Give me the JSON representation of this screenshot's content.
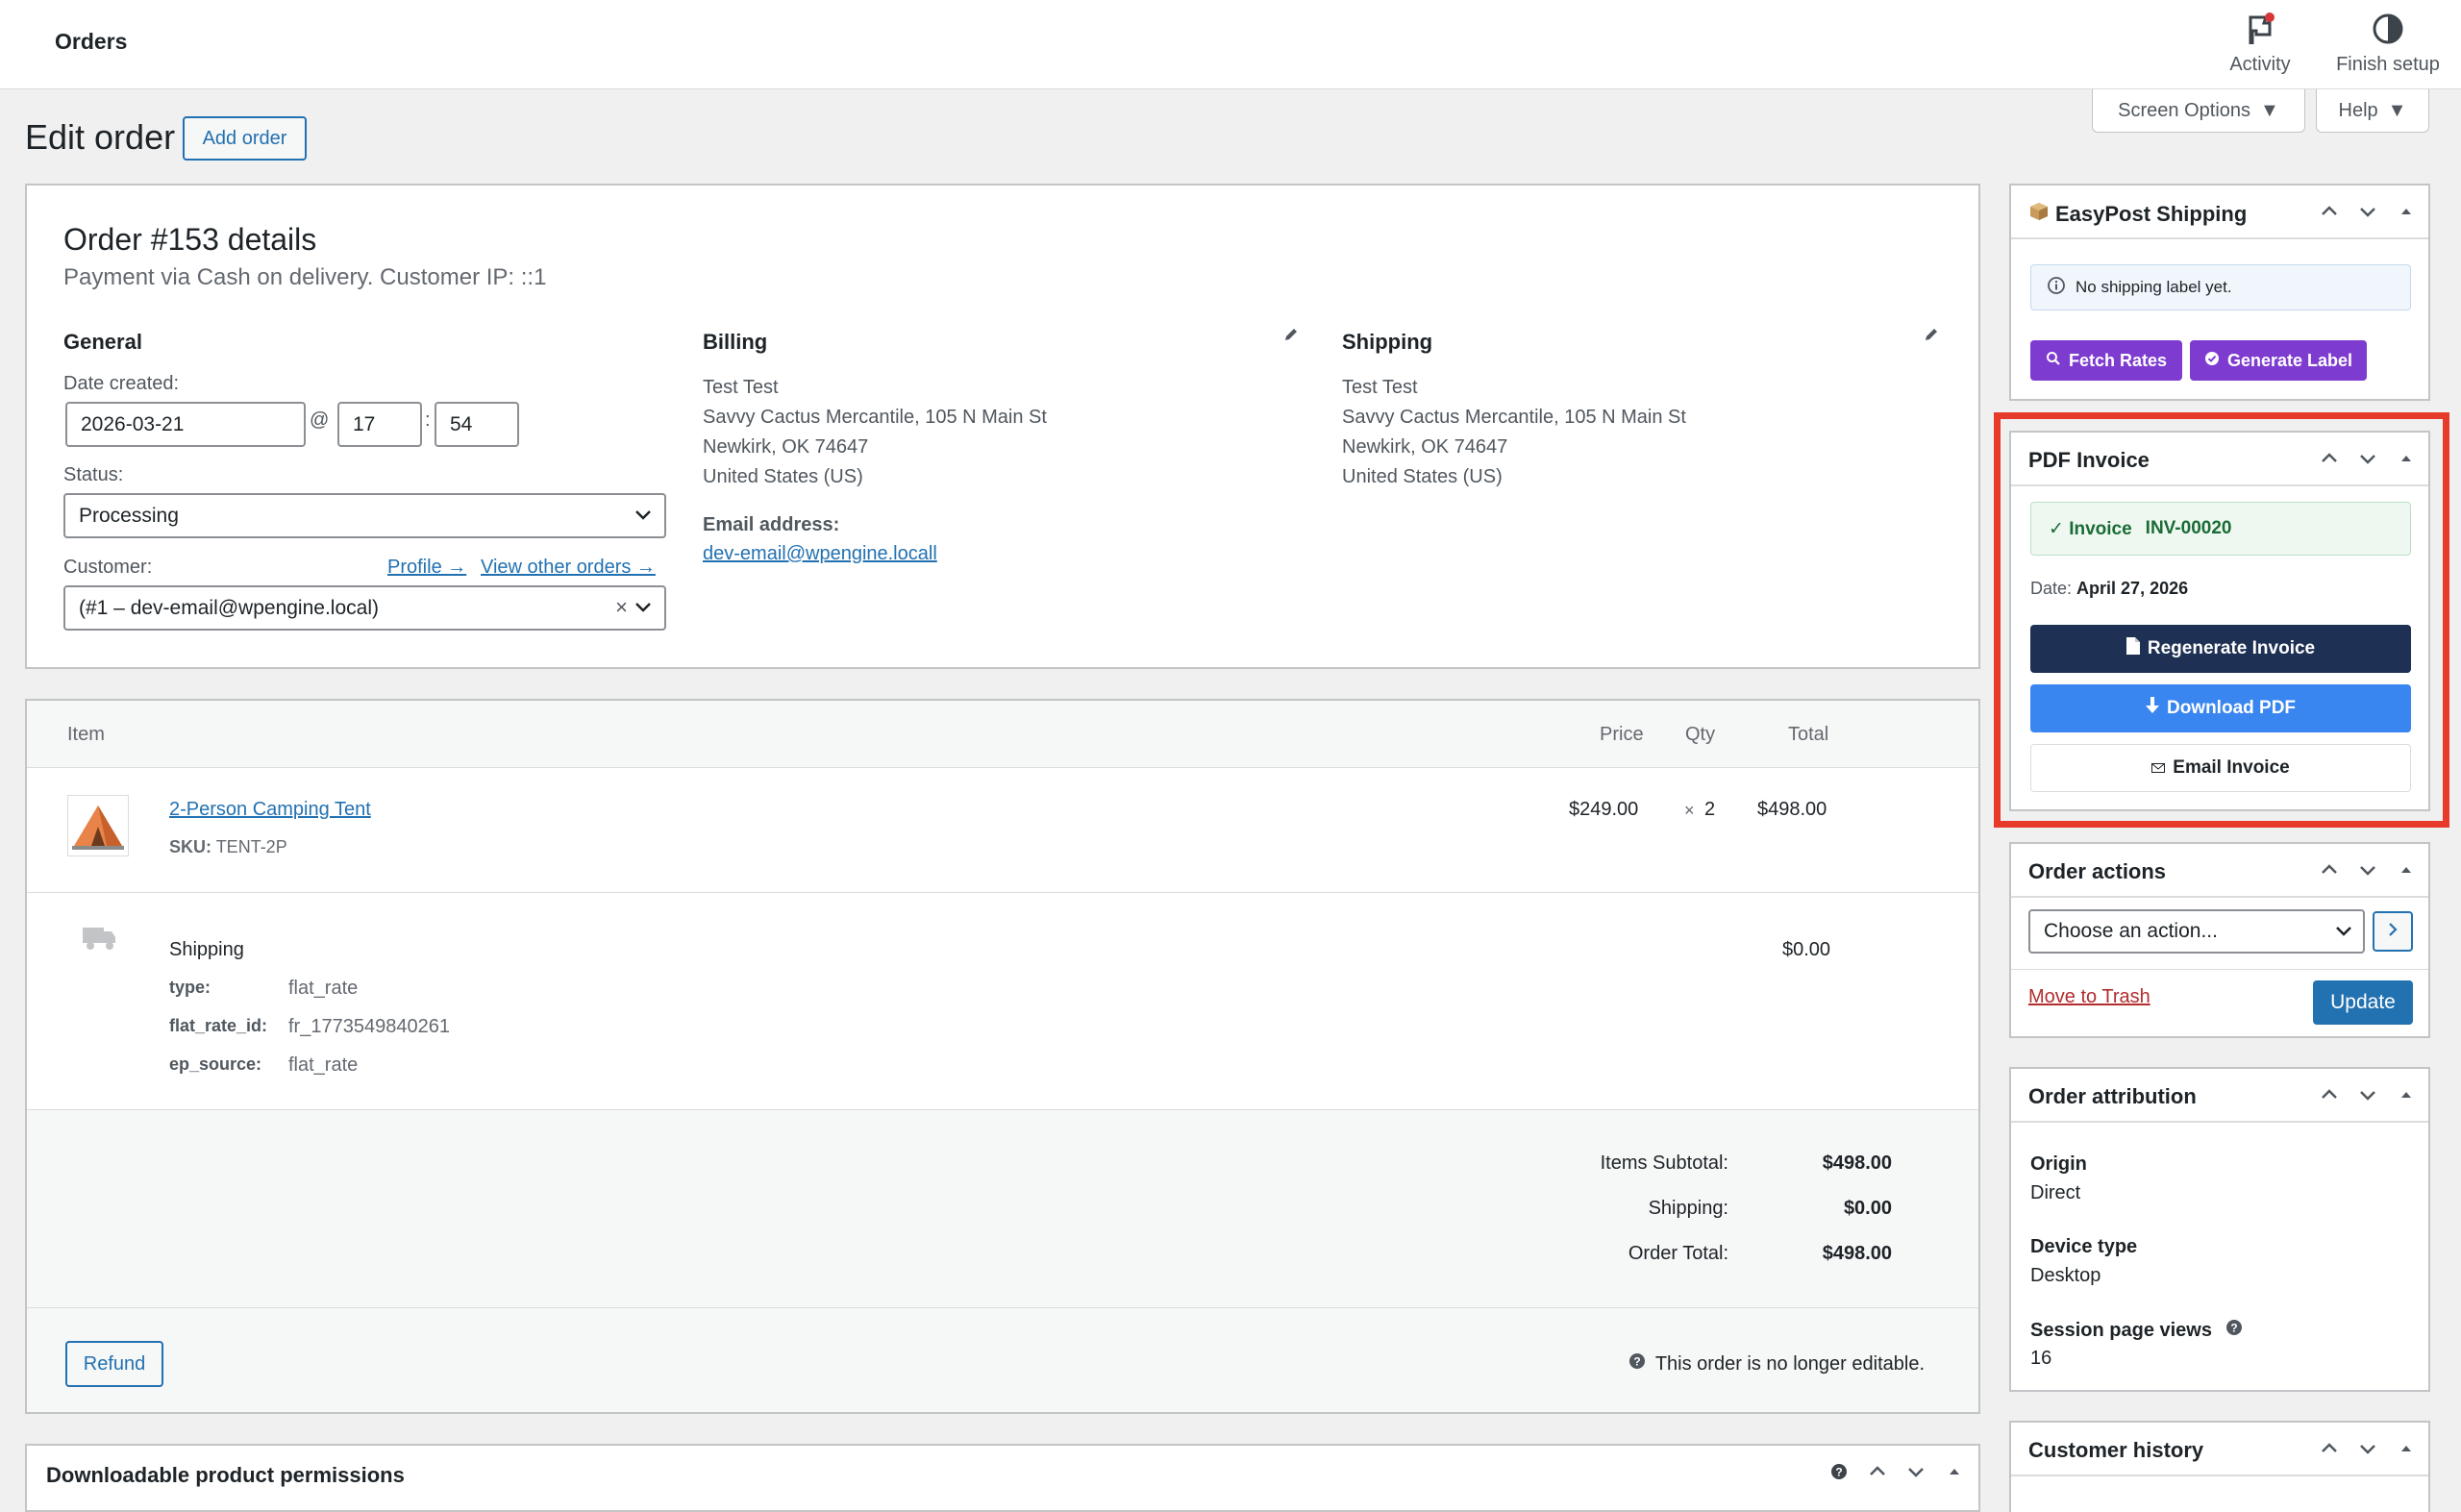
{
  "topbar": {
    "title": "Orders",
    "activity": "Activity",
    "finish_setup": "Finish setup"
  },
  "header": {
    "title": "Edit order",
    "add_order": "Add order",
    "screen_options": "Screen Options",
    "help": "Help"
  },
  "order": {
    "title": "Order #153 details",
    "subtitle": "Payment via Cash on delivery. Customer IP: ::1",
    "general": {
      "heading": "General",
      "date_label": "Date created:",
      "date": "2026-03-21",
      "at": "@",
      "hour": "17",
      "colon": ":",
      "minute": "54",
      "status_label": "Status:",
      "status": "Processing",
      "customer_label": "Customer:",
      "profile_link": "Profile →",
      "other_orders_link": "View other orders →",
      "customer": "(#1 – dev-email@wpengine.local)",
      "clear": "×"
    },
    "billing": {
      "heading": "Billing",
      "lines": [
        "Test Test",
        "Savvy Cactus Mercantile, 105 N Main St",
        "Newkirk, OK 74647",
        "United States (US)"
      ],
      "email_label": "Email address:",
      "email": "dev-email@wpengine.locall"
    },
    "shipping": {
      "heading": "Shipping",
      "lines": [
        "Test Test",
        "Savvy Cactus Mercantile, 105 N Main St",
        "Newkirk, OK 74647",
        "United States (US)"
      ]
    }
  },
  "items": {
    "headers": {
      "item": "Item",
      "price": "Price",
      "qty": "Qty",
      "total": "Total"
    },
    "product": {
      "name": "2-Person Camping Tent",
      "sku_label": "SKU:",
      "sku": "TENT-2P",
      "price": "$249.00",
      "qty_x": "×",
      "qty": "2",
      "total": "$498.00"
    },
    "shipping": {
      "name": "Shipping",
      "total": "$0.00",
      "meta": [
        {
          "key": "type:",
          "value": "flat_rate"
        },
        {
          "key": "flat_rate_id:",
          "value": "fr_1773549840261"
        },
        {
          "key": "ep_source:",
          "value": "flat_rate"
        }
      ]
    },
    "totals": [
      {
        "label": "Items Subtotal:",
        "value": "$498.00"
      },
      {
        "label": "Shipping:",
        "value": "$0.00"
      },
      {
        "label": "Order Total:",
        "value": "$498.00"
      }
    ],
    "refund": "Refund",
    "not_editable": "This order is no longer editable."
  },
  "downloadable": {
    "title": "Downloadable product permissions"
  },
  "sidebar": {
    "easypost": {
      "title": "EasyPost Shipping",
      "notice": "No shipping label yet.",
      "fetch": "Fetch Rates",
      "generate": "Generate Label"
    },
    "pdf": {
      "title": "PDF Invoice",
      "invoice_label": "✓ Invoice",
      "invoice_no": "INV-00020",
      "date_label": "Date:",
      "date": "April 27, 2026",
      "regen": "Regenerate Invoice",
      "download": "Download PDF",
      "email": "Email Invoice"
    },
    "actions": {
      "title": "Order actions",
      "select": "Choose an action...",
      "trash": "Move to Trash",
      "update": "Update"
    },
    "attribution": {
      "title": "Order attribution",
      "origin_label": "Origin",
      "origin": "Direct",
      "device_label": "Device type",
      "device": "Desktop",
      "views_label": "Session page views",
      "views": "16"
    },
    "history": {
      "title": "Customer history"
    }
  },
  "colors": {
    "accent": "#2271b1",
    "purple": "#7e3bd0",
    "navy": "#1e3054",
    "blue": "#3a86f0",
    "highlight": "#e63a2a",
    "success_bg": "#eef8f1"
  }
}
